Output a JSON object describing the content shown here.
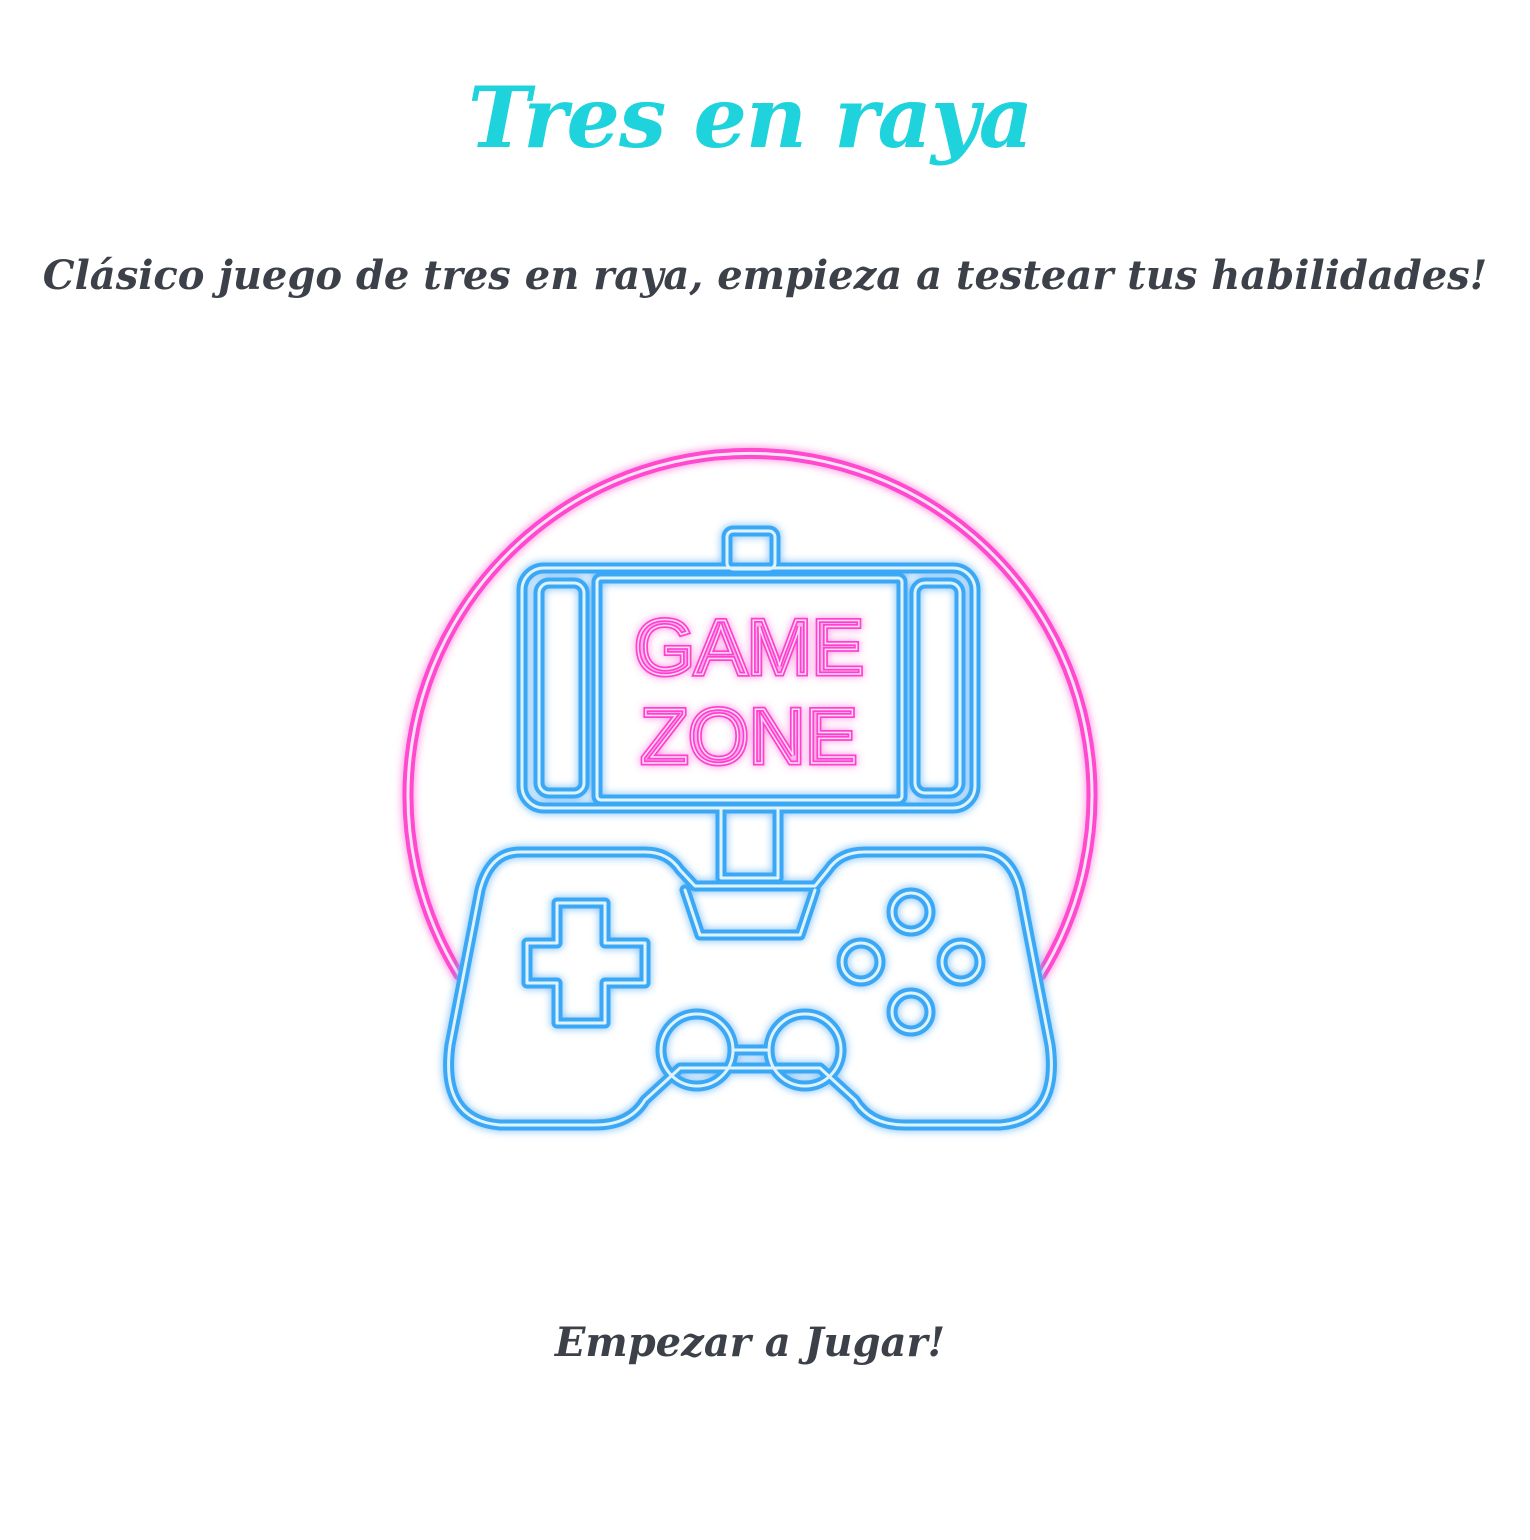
{
  "header": {
    "title": "Tres en raya",
    "subtitle": "Clásico juego de tres en raya, empieza a testear tus habilidades!"
  },
  "logo": {
    "line1": "GAME",
    "line2": "ZONE",
    "icon": "neon-gamepad-icon",
    "colors": {
      "pink": "#ff3fd0",
      "blue": "#3aa8f5"
    }
  },
  "actions": {
    "start_label": "Empezar a Jugar!"
  },
  "colors": {
    "title": "#1fd3dc",
    "text": "#3c4048",
    "background": "#ffffff"
  }
}
